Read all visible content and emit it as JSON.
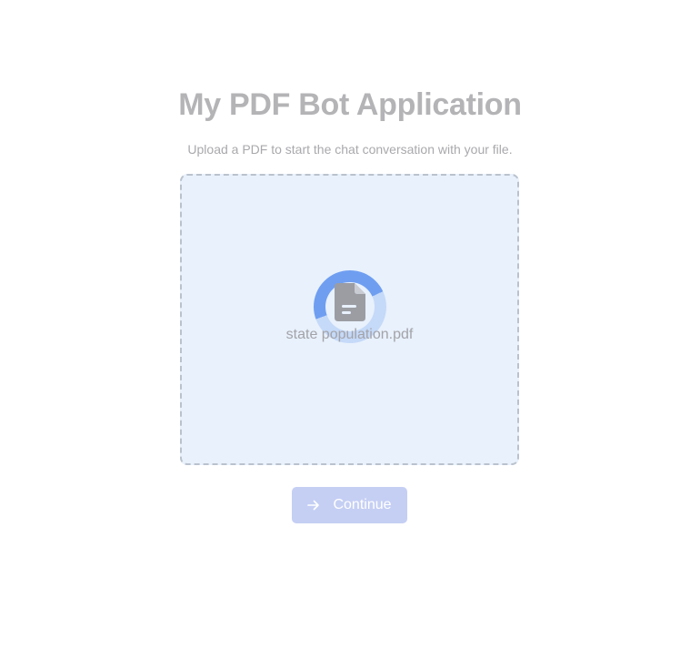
{
  "header": {
    "title": "My PDF Bot Application",
    "subtitle": "Upload a PDF to start the chat conversation with your file."
  },
  "upload": {
    "file_name": "state population.pdf",
    "status_icon": "loading-spinner-icon",
    "file_icon": "file-icon"
  },
  "actions": {
    "continue_label": "Continue",
    "continue_icon": "arrow-right-icon"
  },
  "colors": {
    "title": "#b4b4b7",
    "dropzone_bg": "#e8f1fc",
    "spinner_active": "#6f9ef1",
    "spinner_track": "#c5d9f8",
    "button_bg": "#c5cff4"
  }
}
